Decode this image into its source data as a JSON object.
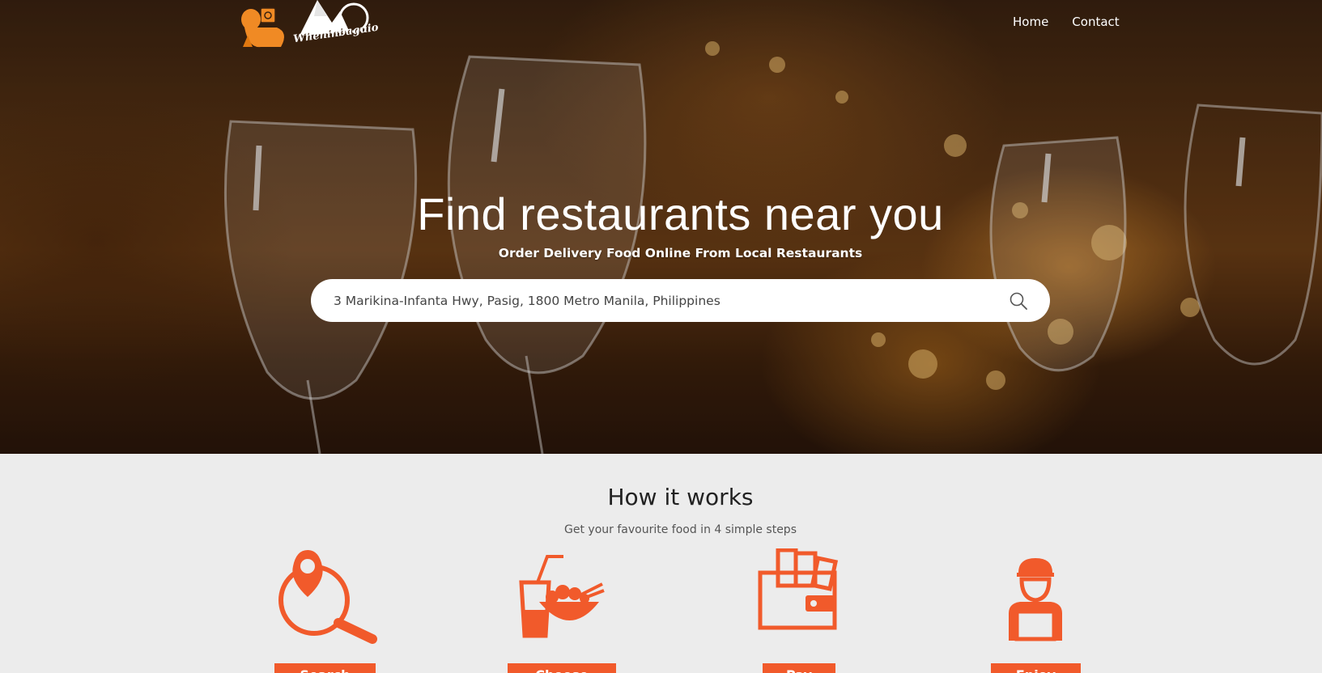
{
  "header": {
    "logo_text": "Wheninbaguio",
    "nav": [
      {
        "label": "Home"
      },
      {
        "label": "Contact"
      }
    ]
  },
  "hero": {
    "title": "Find restaurants near you",
    "subtitle": "Order Delivery Food Online From Local Restaurants",
    "search_value": "3 Marikina-Infanta Hwy, Pasig, 1800 Metro Manila, Philippines"
  },
  "how": {
    "title": "How it works",
    "subtitle": "Get your favourite food in 4 simple steps",
    "steps": [
      {
        "icon": "location-search-icon",
        "label": "Search"
      },
      {
        "icon": "food-drink-icon",
        "label": "Choose"
      },
      {
        "icon": "wallet-icon",
        "label": "Pay"
      },
      {
        "icon": "delivery-man-icon",
        "label": "Enjoy"
      }
    ]
  },
  "colors": {
    "accent": "#f15a2b",
    "logo_orange": "#f08a24",
    "section_bg": "#ececec"
  }
}
